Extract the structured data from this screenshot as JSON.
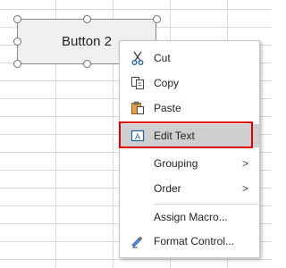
{
  "form_button": {
    "label": "Button 2"
  },
  "context_menu": {
    "items": [
      {
        "label": "Cut",
        "icon": "scissors-icon"
      },
      {
        "label": "Copy",
        "icon": "copy-icon"
      },
      {
        "label": "Paste",
        "icon": "paste-icon"
      },
      {
        "label": "Edit Text",
        "icon": "edit-text-icon",
        "highlighted": true
      },
      {
        "label": "Grouping",
        "submenu": true
      },
      {
        "label": "Order",
        "submenu": true
      },
      {
        "label": "Assign Macro...",
        "icon": ""
      },
      {
        "label": "Format Control...",
        "icon": "format-control-icon"
      }
    ],
    "submenu_arrow": ">"
  },
  "colors": {
    "highlight_border": "#e00000",
    "highlight_fill": "#cfcfcf",
    "gridline": "#d9d9d9"
  }
}
